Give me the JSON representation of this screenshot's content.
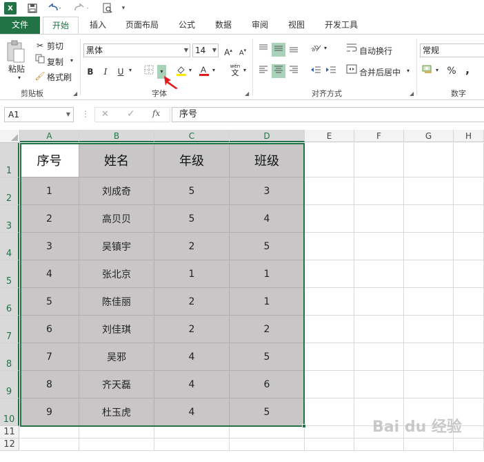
{
  "app": {
    "logo": "X"
  },
  "qat": {
    "icons": [
      "save-icon",
      "undo-icon",
      "redo-icon",
      "print-preview-icon"
    ]
  },
  "tabs": [
    "文件",
    "开始",
    "插入",
    "页面布局",
    "公式",
    "数据",
    "审阅",
    "视图",
    "开发工具"
  ],
  "ribbon": {
    "clipboard": {
      "paste": "粘贴",
      "cut": "剪切",
      "copy": "复制",
      "format_painter": "格式刷",
      "label": "剪贴板"
    },
    "font": {
      "name": "黑体",
      "size": "14",
      "bold": "B",
      "italic": "I",
      "underline": "U",
      "label": "字体",
      "phonetic_top": "wén",
      "phonetic_char": "文"
    },
    "alignment": {
      "wrap_text": "自动换行",
      "merge_center": "合并后居中",
      "label": "对齐方式"
    },
    "number": {
      "format": "常规",
      "percent": "%",
      "comma": ",",
      "label": "数字"
    }
  },
  "formula_bar": {
    "name_box": "A1",
    "fx": "fx",
    "value": "序号"
  },
  "columns": [
    "A",
    "B",
    "C",
    "D",
    "E",
    "F",
    "G",
    "H"
  ],
  "rows": [
    "1",
    "2",
    "3",
    "4",
    "5",
    "6",
    "7",
    "8",
    "9",
    "10",
    "11",
    "12"
  ],
  "table": {
    "headers": [
      "序号",
      "姓名",
      "年级",
      "班级"
    ],
    "rows": [
      [
        "1",
        "刘成奇",
        "5",
        "3"
      ],
      [
        "2",
        "高贝贝",
        "5",
        "4"
      ],
      [
        "3",
        "吴镇宇",
        "2",
        "5"
      ],
      [
        "4",
        "张北京",
        "1",
        "1"
      ],
      [
        "5",
        "陈佳丽",
        "2",
        "1"
      ],
      [
        "6",
        "刘佳琪",
        "2",
        "2"
      ],
      [
        "7",
        "吴邪",
        "4",
        "5"
      ],
      [
        "8",
        "齐天磊",
        "4",
        "6"
      ],
      [
        "9",
        "杜玉虎",
        "4",
        "5"
      ]
    ]
  },
  "watermark": "Bai du 经验",
  "colors": {
    "accent": "#217346",
    "selection_fill": "#c8c6c7",
    "active_button": "#a9d3b8"
  }
}
